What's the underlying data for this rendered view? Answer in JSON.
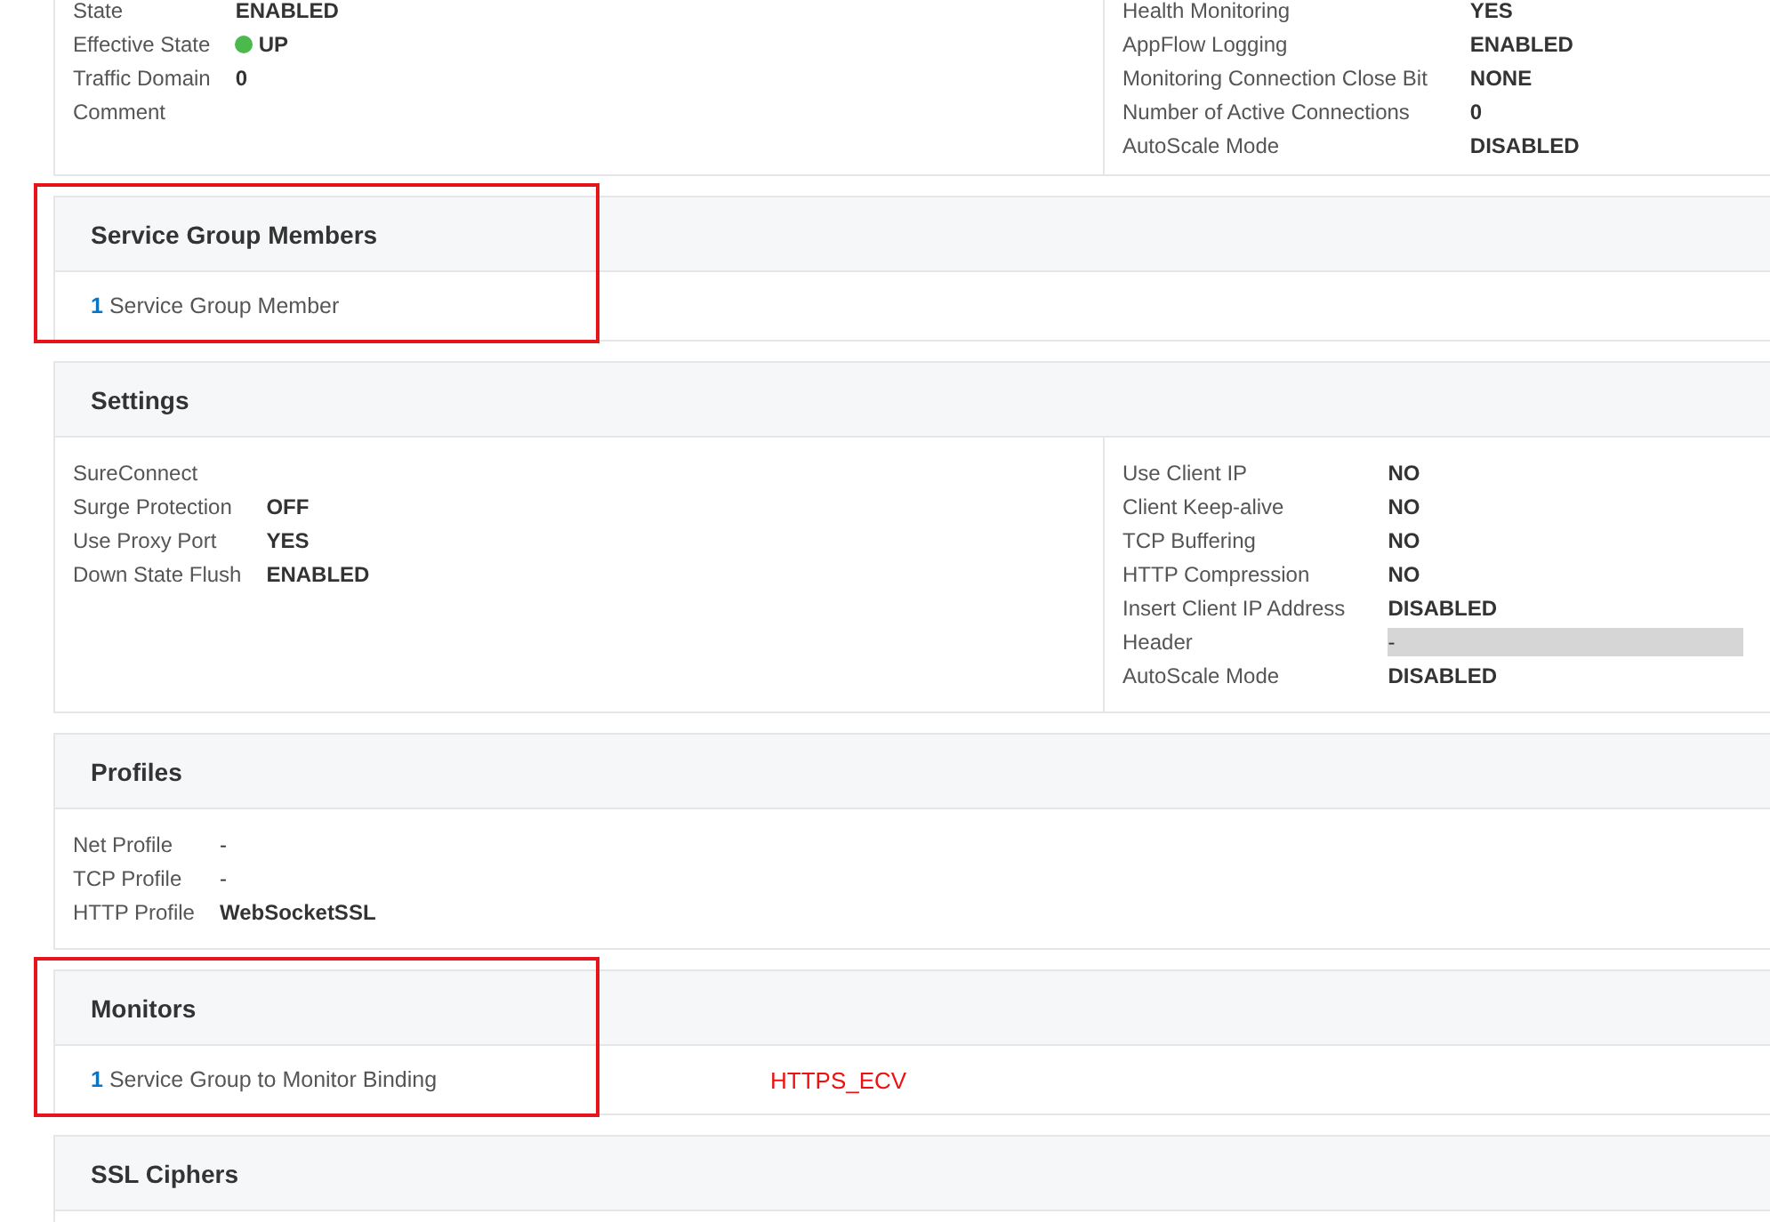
{
  "overview": {
    "left": [
      {
        "label": "State",
        "value": "ENABLED"
      },
      {
        "label": "Effective State",
        "value": "UP",
        "kind": "status"
      },
      {
        "label": "Traffic Domain",
        "value": "0"
      },
      {
        "label": "Comment"
      }
    ],
    "right": [
      {
        "label": "Health Monitoring",
        "value": "YES"
      },
      {
        "label": "AppFlow Logging",
        "value": "ENABLED"
      },
      {
        "label": "Monitoring Connection Close Bit",
        "value": "NONE"
      },
      {
        "label": "Number of Active Connections",
        "value": "0"
      },
      {
        "label": "AutoScale Mode",
        "value": "DISABLED"
      }
    ]
  },
  "sections": [
    {
      "kind": "link",
      "title": "Service Group Members",
      "highlighted": true,
      "count": "1",
      "text": "Service Group Member"
    },
    {
      "kind": "columns",
      "title": "Settings",
      "highlighted": false,
      "left": [
        {
          "label": "SureConnect"
        },
        {
          "label": "Surge Protection",
          "value": "OFF"
        },
        {
          "label": "Use Proxy Port",
          "value": "YES"
        },
        {
          "label": "Down State Flush",
          "value": "ENABLED"
        }
      ],
      "right": [
        {
          "label": "Use Client IP",
          "value": "NO"
        },
        {
          "label": "Client Keep-alive",
          "value": "NO"
        },
        {
          "label": "TCP Buffering",
          "value": "NO"
        },
        {
          "label": "HTTP Compression",
          "value": "NO"
        },
        {
          "label": "Insert Client IP Address",
          "value": "DISABLED"
        },
        {
          "label": "Header",
          "value": "-",
          "kind": "field"
        },
        {
          "label": "AutoScale Mode",
          "value": "DISABLED"
        }
      ]
    },
    {
      "kind": "list",
      "title": "Profiles",
      "highlighted": false,
      "rows": [
        {
          "label": "Net Profile",
          "value": "-",
          "plain": true
        },
        {
          "label": "TCP Profile",
          "value": "-",
          "plain": true
        },
        {
          "label": "HTTP Profile",
          "value": "WebSocketSSL",
          "plain": false
        }
      ]
    },
    {
      "kind": "link",
      "title": "Monitors",
      "highlighted": true,
      "count": "1",
      "text": "Service Group to Monitor Binding",
      "note": "HTTPS_ECV"
    },
    {
      "kind": "empty",
      "title": "SSL Ciphers",
      "highlighted": false
    }
  ]
}
